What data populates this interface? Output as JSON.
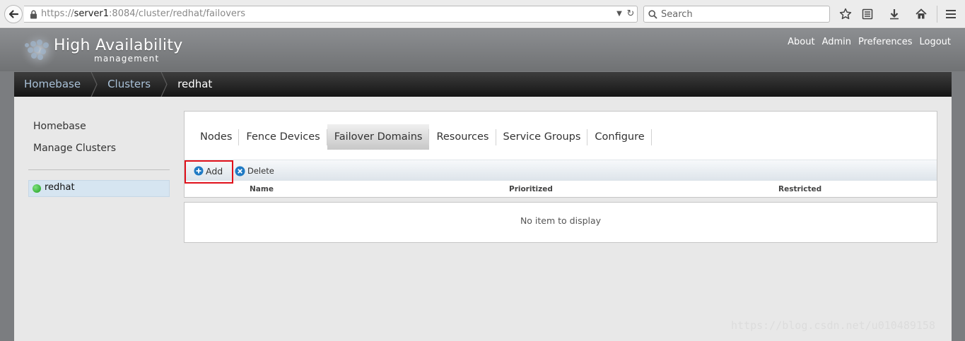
{
  "browser": {
    "url_scheme": "https://",
    "url_host": "server1",
    "url_rest": ":8084/cluster/redhat/failovers",
    "search_placeholder": "Search"
  },
  "app": {
    "title": "High Availability",
    "subtitle": "management",
    "top_links": [
      "About",
      "Admin",
      "Preferences",
      "Logout"
    ]
  },
  "breadcrumb": [
    "Homebase",
    "Clusters",
    "redhat"
  ],
  "sidebar": {
    "links": [
      "Homebase",
      "Manage Clusters"
    ],
    "clusters": [
      {
        "name": "redhat",
        "status_color": "#2fb52f"
      }
    ]
  },
  "tabs": [
    {
      "label": "Nodes",
      "active": false
    },
    {
      "label": "Fence Devices",
      "active": false
    },
    {
      "label": "Failover Domains",
      "active": true
    },
    {
      "label": "Resources",
      "active": false
    },
    {
      "label": "Service Groups",
      "active": false
    },
    {
      "label": "Configure",
      "active": false
    }
  ],
  "toolbar": {
    "add_label": "Add",
    "delete_label": "Delete"
  },
  "table": {
    "columns": [
      "Name",
      "Prioritized",
      "Restricted"
    ],
    "empty_text": "No item to display"
  },
  "watermark": "https://blog.csdn.net/u010489158",
  "colors": {
    "highlight": "#e0101a",
    "link": "#a9c1d8",
    "add_icon": "#1f7ac4",
    "delete_icon": "#1f7ac4"
  }
}
